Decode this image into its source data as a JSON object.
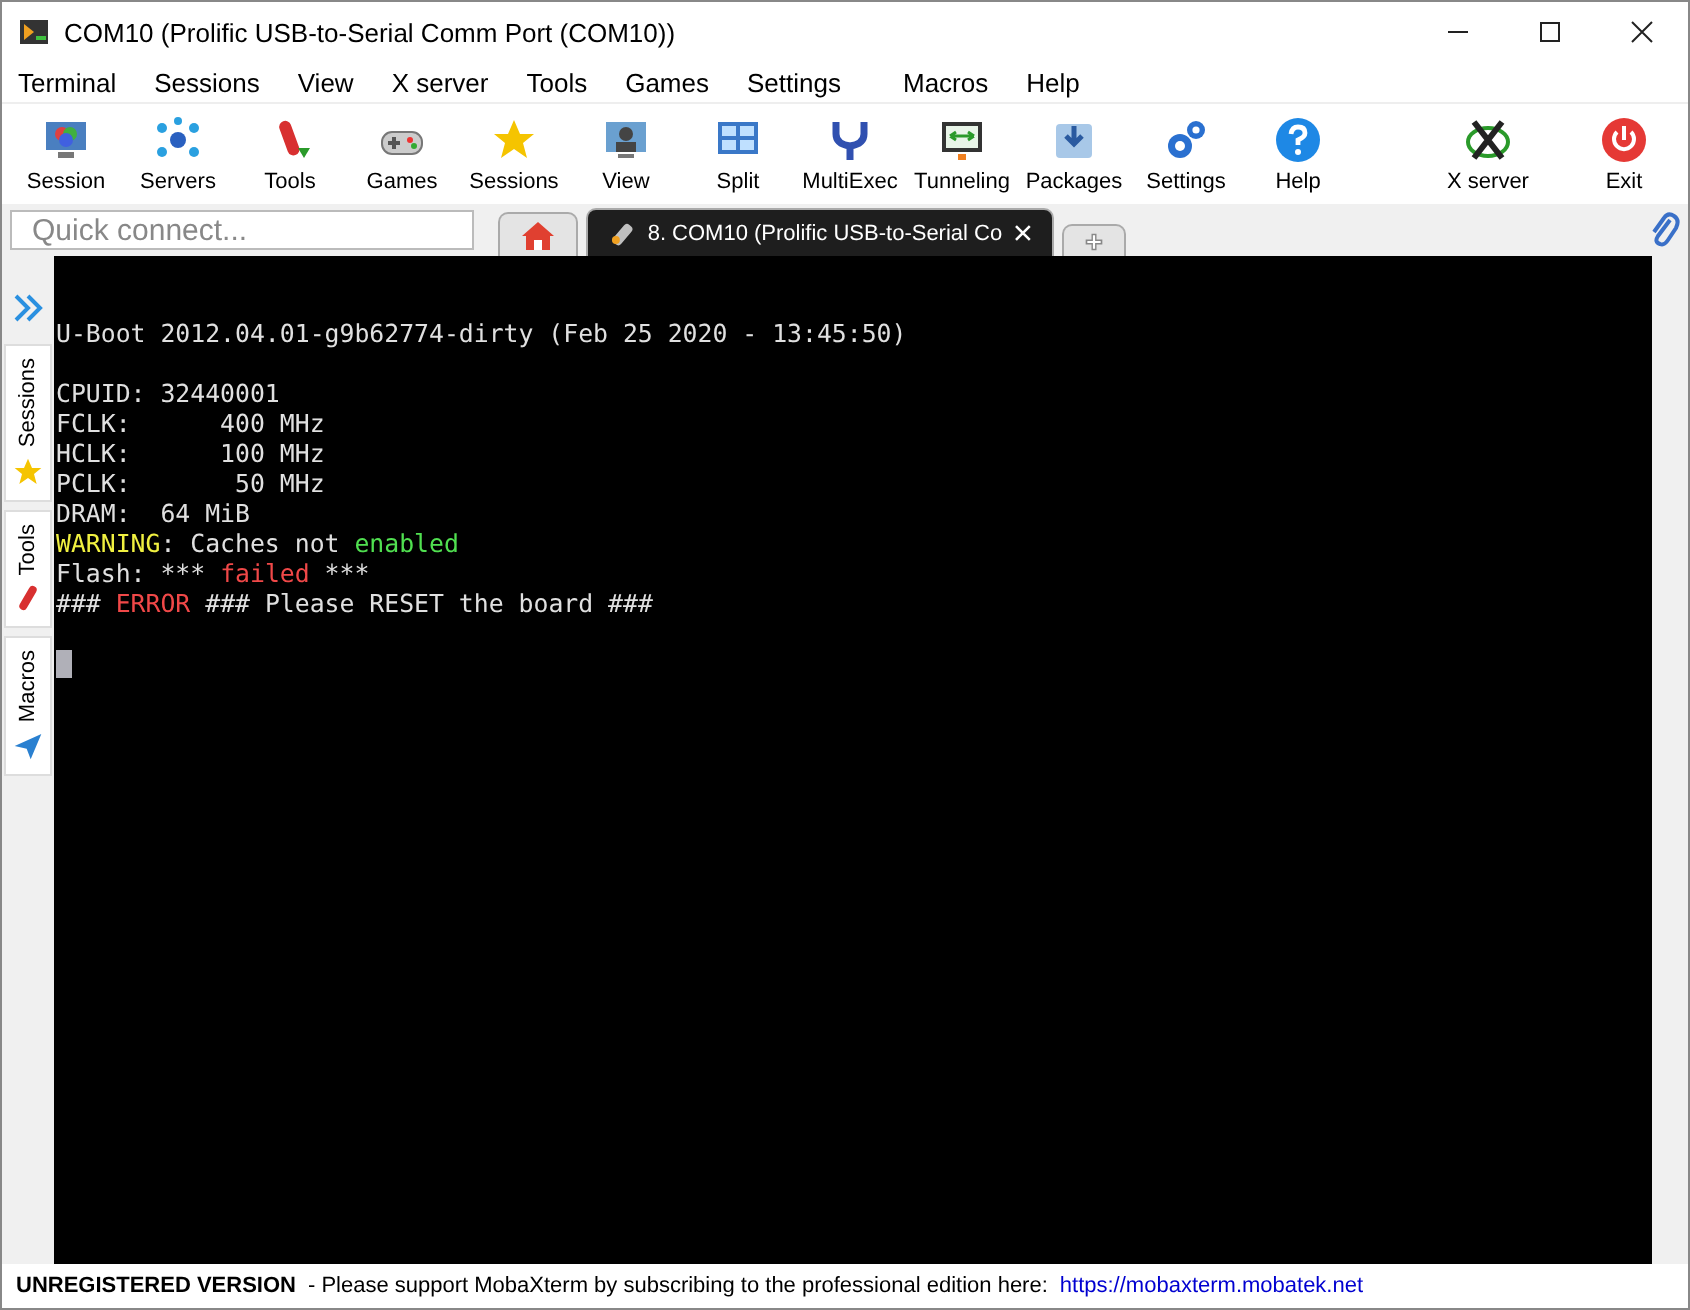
{
  "window": {
    "title": "COM10  (Prolific USB-to-Serial Comm Port (COM10))"
  },
  "menu": [
    "Terminal",
    "Sessions",
    "View",
    "X server",
    "Tools",
    "Games",
    "Settings",
    "Macros",
    "Help"
  ],
  "toolbar": [
    {
      "label": "Session"
    },
    {
      "label": "Servers"
    },
    {
      "label": "Tools"
    },
    {
      "label": "Games"
    },
    {
      "label": "Sessions"
    },
    {
      "label": "View"
    },
    {
      "label": "Split"
    },
    {
      "label": "MultiExec"
    },
    {
      "label": "Tunneling"
    },
    {
      "label": "Packages"
    },
    {
      "label": "Settings"
    },
    {
      "label": "Help"
    }
  ],
  "toolbar_right": [
    {
      "label": "X server"
    },
    {
      "label": "Exit"
    }
  ],
  "quick_connect": {
    "placeholder": "Quick connect..."
  },
  "tabs": [
    {
      "kind": "home",
      "selected": false
    },
    {
      "kind": "session",
      "label": "8. COM10 (Prolific USB-to-Serial Co",
      "selected": true
    },
    {
      "kind": "new",
      "selected": false
    }
  ],
  "sidebar": [
    "Sessions",
    "Tools",
    "Macros"
  ],
  "terminal_blocks": [
    {
      "lines": [
        [
          {
            "text": "U-Boot 2012.04.01-g9b62774-dirty (Feb 25 2020 - 13:45:50)",
            "color": "#e0e0e0"
          }
        ]
      ]
    },
    {
      "lines": [
        [
          {
            "text": "CPUID: 32440001",
            "color": "#e0e0e0"
          }
        ],
        [
          {
            "text": "FCLK:      400 MHz",
            "color": "#e0e0e0"
          }
        ],
        [
          {
            "text": "HCLK:      100 MHz",
            "color": "#e0e0e0"
          }
        ],
        [
          {
            "text": "PCLK:       50 MHz",
            "color": "#e0e0e0"
          }
        ],
        [
          {
            "text": "DRAM:  64 MiB",
            "color": "#e0e0e0"
          }
        ],
        [
          {
            "text": "WARNING",
            "color": "#f0f040"
          },
          {
            "text": ": Caches not ",
            "color": "#e0e0e0"
          },
          {
            "text": "enabled",
            "color": "#50e050"
          }
        ],
        [
          {
            "text": "Flash: *** ",
            "color": "#e0e0e0"
          },
          {
            "text": "failed",
            "color": "#f04848"
          },
          {
            "text": " ***",
            "color": "#e0e0e0"
          }
        ],
        [
          {
            "text": "### ",
            "color": "#e0e0e0"
          },
          {
            "text": "ERROR",
            "color": "#f04848"
          },
          {
            "text": " ### Please RESET the board ###",
            "color": "#e0e0e0"
          }
        ]
      ]
    }
  ],
  "status_bar": {
    "label": "UNREGISTERED VERSION",
    "message": "-  Please support MobaXterm by subscribing to the professional edition here:",
    "link": "https://mobaxterm.mobatek.net"
  }
}
